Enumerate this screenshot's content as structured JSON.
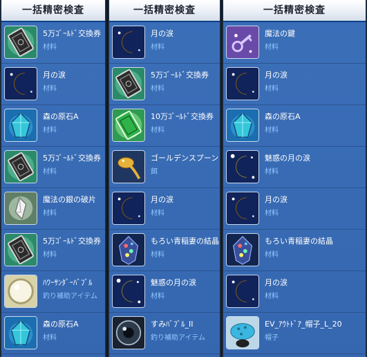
{
  "panels": [
    {
      "title": "一括精密検査",
      "items": [
        {
          "name": "5万ｺﾞｰﾙﾄﾞ交換券",
          "category": "材料",
          "icon": "gold-ticket-icon"
        },
        {
          "name": "月の涙",
          "category": "材料",
          "icon": "moon-tear-icon"
        },
        {
          "name": "森の原石A",
          "category": "材料",
          "icon": "forest-gem-icon"
        },
        {
          "name": "5万ｺﾞｰﾙﾄﾞ交換券",
          "category": "材料",
          "icon": "gold-ticket-icon"
        },
        {
          "name": "魔法の銀の破片",
          "category": "材料",
          "icon": "silver-shard-icon"
        },
        {
          "name": "5万ｺﾞｰﾙﾄﾞ交換券",
          "category": "材料",
          "icon": "gold-ticket-icon"
        },
        {
          "name": "ﾊﾜｰｻﾝﾀﾞｰﾊﾞﾌﾞﾙ",
          "category": "釣り補助アイテム",
          "icon": "thunder-bubble-icon"
        },
        {
          "name": "森の原石A",
          "category": "材料",
          "icon": "forest-gem-icon"
        }
      ]
    },
    {
      "title": "一括精密検査",
      "items": [
        {
          "name": "月の涙",
          "category": "材料",
          "icon": "moon-tear-icon"
        },
        {
          "name": "5万ｺﾞｰﾙﾄﾞ交換券",
          "category": "材料",
          "icon": "gold-ticket-icon"
        },
        {
          "name": "10万ｺﾞｰﾙﾄﾞ交換券",
          "category": "材料",
          "icon": "green-ticket-icon"
        },
        {
          "name": "ゴールデンスプーン",
          "category": "餌",
          "icon": "golden-spoon-icon"
        },
        {
          "name": "月の涙",
          "category": "材料",
          "icon": "moon-tear-icon"
        },
        {
          "name": "もろい青稲妻の結晶",
          "category": "材料",
          "icon": "lightning-crystal-icon"
        },
        {
          "name": "魅惑の月の涙",
          "category": "材料",
          "icon": "charm-moon-tear-icon"
        },
        {
          "name": "すみﾊﾞﾌﾞﾙ_II",
          "category": "釣り補助アイテム",
          "icon": "ink-bubble-icon"
        }
      ]
    },
    {
      "title": "一括精密検査",
      "items": [
        {
          "name": "魔法の鍵",
          "category": "材料",
          "icon": "magic-key-icon"
        },
        {
          "name": "月の涙",
          "category": "材料",
          "icon": "moon-tear-icon"
        },
        {
          "name": "森の原石A",
          "category": "材料",
          "icon": "forest-gem-icon"
        },
        {
          "name": "魅惑の月の涙",
          "category": "材料",
          "icon": "charm-moon-tear-icon"
        },
        {
          "name": "月の涙",
          "category": "材料",
          "icon": "moon-tear-icon"
        },
        {
          "name": "もろい青稲妻の結晶",
          "category": "材料",
          "icon": "lightning-crystal-icon"
        },
        {
          "name": "月の涙",
          "category": "材料",
          "icon": "moon-tear-icon"
        },
        {
          "name": "EV_ｱｳﾄﾄﾞｱ_帽子_L_20",
          "category": "帽子",
          "icon": "blue-hat-icon"
        }
      ]
    }
  ],
  "colors": {
    "panel_bg": "#3b6fb8",
    "item_name": "#ffffff",
    "item_category": "#8fc7ff",
    "title_text": "#1e2430"
  }
}
